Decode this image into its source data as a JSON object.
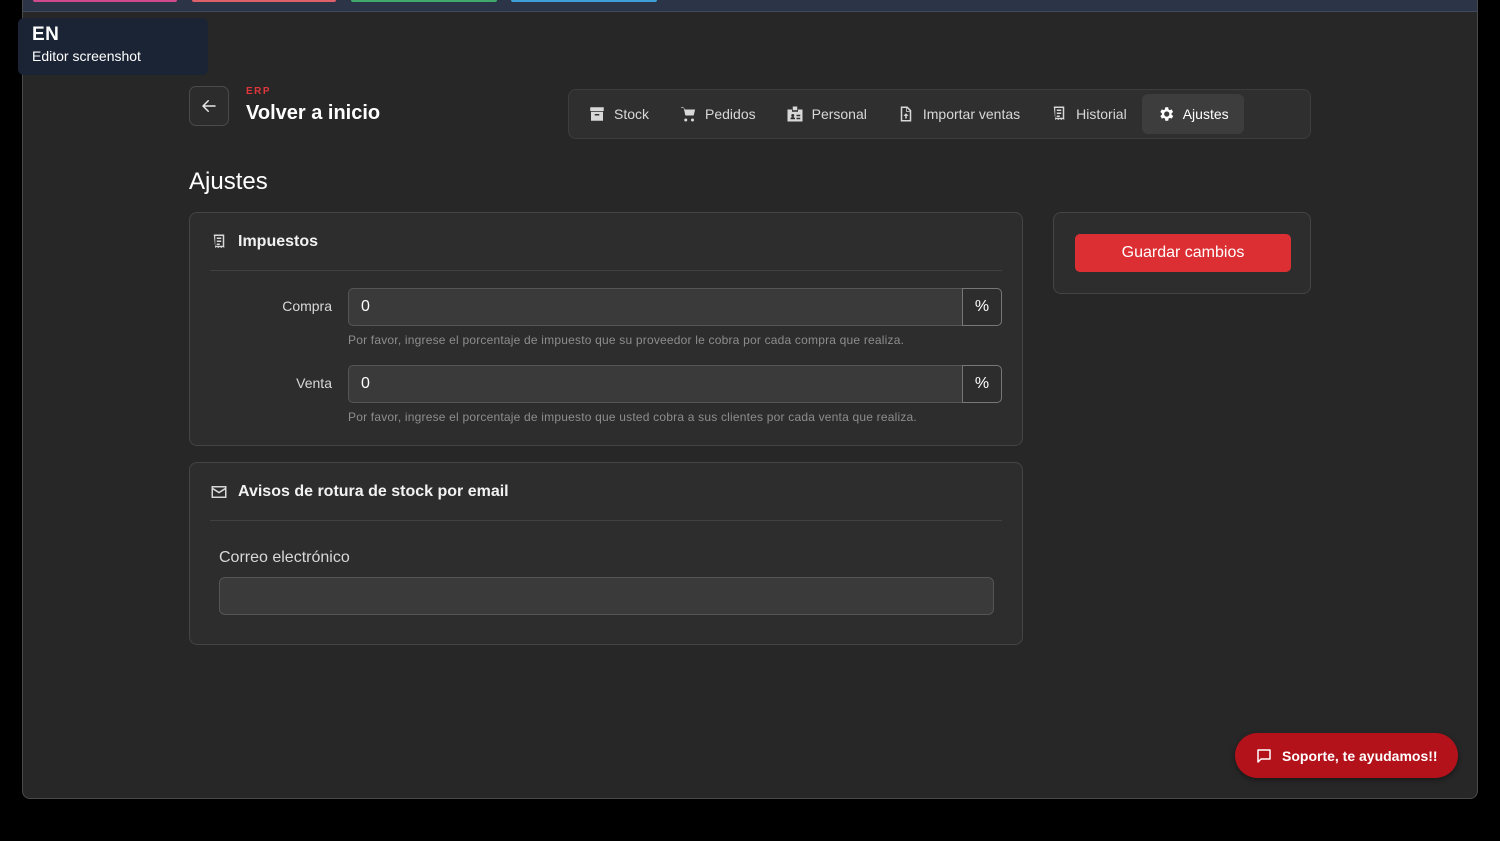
{
  "colors": {
    "accent": "#dc2f33",
    "background": "#272727",
    "support": "#b3121a"
  },
  "lang_badge": {
    "code": "EN",
    "caption": "Editor screenshot"
  },
  "header": {
    "section": "ERP",
    "back_title": "Volver a inicio"
  },
  "nav": [
    {
      "label": "Stock",
      "icon": "archive-icon"
    },
    {
      "label": "Pedidos",
      "icon": "cart-icon"
    },
    {
      "label": "Personal",
      "icon": "badge-icon"
    },
    {
      "label": "Importar ventas",
      "icon": "file-upload-icon"
    },
    {
      "label": "Historial",
      "icon": "receipt-icon"
    },
    {
      "label": "Ajustes",
      "icon": "gear-icon",
      "active": true
    }
  ],
  "page_title": "Ajustes",
  "taxes": {
    "title": "Impuestos",
    "purchase": {
      "label": "Compra",
      "value": "0",
      "suffix": "%",
      "help": "Por favor, ingrese el porcentaje de impuesto que su proveedor le cobra por cada compra que realiza."
    },
    "sale": {
      "label": "Venta",
      "value": "0",
      "suffix": "%",
      "help": "Por favor, ingrese el porcentaje de impuesto que usted cobra a sus clientes por cada venta que realiza."
    }
  },
  "stock_alerts": {
    "title": "Avisos de rotura de stock por email",
    "email_label": "Correo electrónico",
    "email_value": ""
  },
  "save_button": "Guardar cambios",
  "support_button": "Soporte, te ayudamos!!"
}
